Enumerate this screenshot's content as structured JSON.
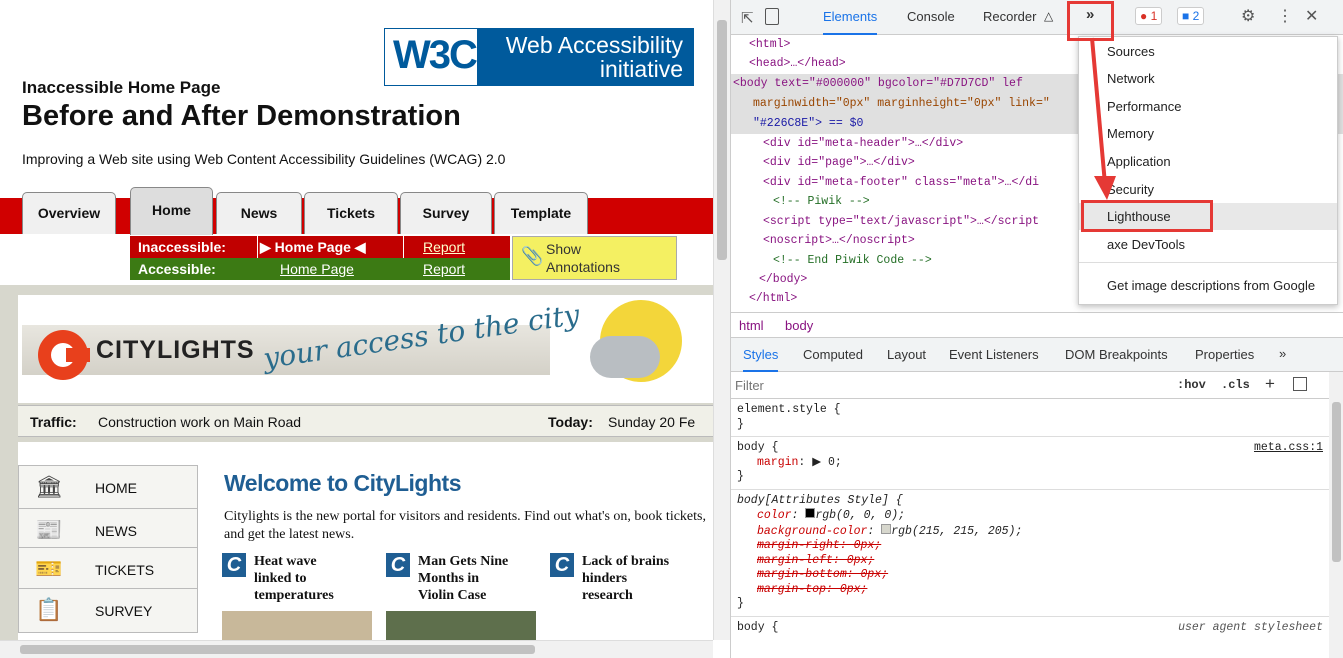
{
  "page": {
    "w3c_mark": "W3C",
    "w3c_line1": "Web Accessibility",
    "w3c_line2": "initiative",
    "title_small": "Inaccessible Home Page",
    "title_big": "Before and After Demonstration",
    "subtitle": "Improving a Web site using Web Content Accessibility Guidelines (WCAG) 2.0",
    "tabs": [
      "Overview",
      "Home",
      "News",
      "Tickets",
      "Survey",
      "Template"
    ],
    "ann": {
      "inacc_label": "Inaccessible:",
      "acc_label": "Accessible:",
      "inacc_home": "▶ Home Page ◀",
      "acc_home": "Home Page",
      "report": "Report",
      "show_line1": "Show",
      "show_line2": "Annotations"
    },
    "banner": {
      "name": "CITYLIGHTS",
      "slogan": "your access to the city"
    },
    "traffic_label": "Traffic:",
    "traffic_text": "Construction work on Main Road",
    "today_label": "Today:",
    "today_text": "Sunday 20 Fe",
    "nav": [
      "HOME",
      "NEWS",
      "TICKETS",
      "SURVEY"
    ],
    "welcome": "Welcome to CityLights",
    "intro": "Citylights is the new portal for visitors and residents. Find out what's on, book tickets, and get the latest news.",
    "news": [
      {
        "line1": "Heat wave",
        "line2": "linked to",
        "line3": "temperatures"
      },
      {
        "line1": "Man Gets Nine",
        "line2": "Months in",
        "line3": "Violin Case"
      },
      {
        "line1": "Lack of brains",
        "line2": "hinders",
        "line3": "research"
      }
    ]
  },
  "devtools": {
    "tabs": [
      "Elements",
      "Console",
      "Recorder"
    ],
    "more": "»",
    "errors": "1",
    "messages": "2",
    "dom": {
      "html_open": "<html>",
      "head": "<head>…</head>",
      "body_open": "<body text=\"#000000\" bgcolor=\"#D7D7CD\" lef",
      "body_open2": "marginwidth=\"0px\" marginheight=\"0px\" link=\"",
      "body_open3": "\"#226C8E\"> == $0",
      "div1": "<div id=\"meta-header\">…</div>",
      "div2": "<div id=\"page\">…</div>",
      "div3": "<div id=\"meta-footer\" class=\"meta\">…</di",
      "c1": "<!-- Piwik -->",
      "script": "<script type=\"text/javascript\">…</script",
      "noscript": "<noscript>…</noscript>",
      "c2": "<!-- End Piwik Code -->",
      "body_close": "</body>",
      "html_close": "</html>"
    },
    "crumbs": [
      "html",
      "body"
    ],
    "style_tabs": [
      "Styles",
      "Computed",
      "Layout",
      "Event Listeners",
      "DOM Breakpoints",
      "Properties",
      "»"
    ],
    "filter_placeholder": "Filter",
    "hov": ":hov",
    "cls": ".cls",
    "plus": "+",
    "styles": {
      "elstyle": "element.style {",
      "close": "}",
      "body_sel": "body {",
      "margin_prop": "margin",
      "margin_val": ": ▶ 0;",
      "meta_link": "meta.css:1",
      "attr_sel": "body[Attributes Style] {",
      "color_prop": "color",
      "color_val": "rgb(0, 0, 0);",
      "bg_prop": "background-color",
      "bg_val": "rgb(215, 215, 205);",
      "mr": "margin-right: 0px;",
      "ml": "margin-left: 0px;",
      "mb": "margin-bottom: 0px;",
      "mt": "margin-top: 0px;",
      "body2": "body {",
      "ua": "user agent stylesheet"
    },
    "menu": [
      "Sources",
      "Network",
      "Performance",
      "Memory",
      "Application",
      "Security",
      "Lighthouse",
      "axe DevTools",
      "Get image descriptions from Google"
    ]
  }
}
